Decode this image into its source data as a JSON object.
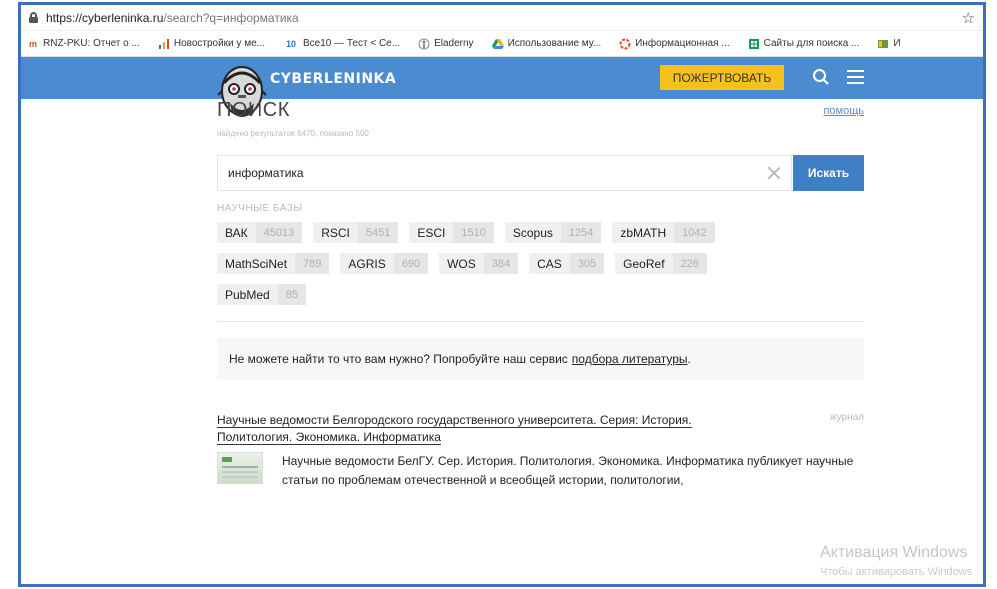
{
  "browser": {
    "url_host": "https://cyberleninka.ru",
    "url_path": "/search?q=информатика",
    "bookmarks": [
      {
        "icon": "rnz-icon",
        "label": "RNZ-PKU: Отчет о ..."
      },
      {
        "icon": "chart-icon",
        "label": "Новостройки у ме..."
      },
      {
        "icon": "vse10-icon",
        "label": "Все10 — Тест < Се..."
      },
      {
        "icon": "elademy-icon",
        "label": "Eladerny"
      },
      {
        "icon": "drive-icon",
        "label": "Использование му..."
      },
      {
        "icon": "circle-icon",
        "label": "Информационная ..."
      },
      {
        "icon": "sheet-icon",
        "label": "Сайты для поиска ..."
      },
      {
        "icon": "book-icon",
        "label": "И"
      }
    ]
  },
  "header": {
    "logo_text": "CYBERLENINKA",
    "donate_label": "ПОЖЕРТВОВАТЬ"
  },
  "search": {
    "title": "ПОИСК",
    "help_label": "помощь",
    "found_text": "найдено результатов 6470, показано 500",
    "query": "информатика",
    "button_label": "Искать"
  },
  "databases": {
    "label": "НАУЧНЫЕ БАЗЫ",
    "items": [
      {
        "name": "ВАК",
        "count": "45013"
      },
      {
        "name": "RSCI",
        "count": "5451"
      },
      {
        "name": "ESCI",
        "count": "1510"
      },
      {
        "name": "Scopus",
        "count": "1254"
      },
      {
        "name": "zbMATH",
        "count": "1042"
      },
      {
        "name": "MathSciNet",
        "count": "789"
      },
      {
        "name": "AGRIS",
        "count": "690"
      },
      {
        "name": "WOS",
        "count": "384"
      },
      {
        "name": "CAS",
        "count": "305"
      },
      {
        "name": "GeoRef",
        "count": "226"
      },
      {
        "name": "PubMed",
        "count": "85"
      }
    ]
  },
  "suggest": {
    "text": "Не можете найти то что вам нужно? Попробуйте наш сервис",
    "link": "подбора литературы",
    "tail": "."
  },
  "result": {
    "title": "Научные ведомости Белгородского государственного университета. Серия: История. Политология. Экономика. Информатика",
    "type": "журнал",
    "description": "Научные ведомости БелГУ. Сер. История. Политология. Экономика. Информатика публикует научные статьи по проблемам отечественной и всеобщей истории, политологии,"
  },
  "watermark": {
    "line1": "Активация Windows",
    "line2": "Чтобы активировать Windows"
  }
}
